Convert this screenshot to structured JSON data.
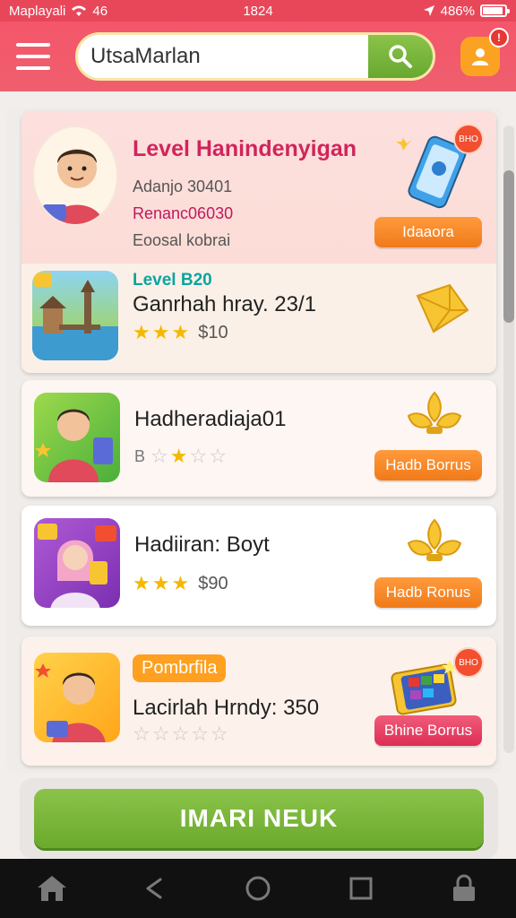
{
  "status_bar": {
    "carrier": "Maplayali",
    "network": "46",
    "time": "1824",
    "battery": "486%",
    "battery_level": 0.86
  },
  "header": {
    "search_value": "UtsaMarlan",
    "notification_count": "!"
  },
  "cards": [
    {
      "title": "Level Hanindenyigan",
      "line1": "Adanjo 30401",
      "line2": "Renanc06030",
      "line3": "Eoosal kobrai",
      "button": "Idaaora",
      "badge": "BHO"
    },
    {
      "level": "Level B20",
      "title": "Ganrhah hray. 23/1",
      "rating": 3,
      "price": "$10"
    },
    {
      "title": "Hadheradiaja01",
      "rating": 1,
      "price_icon": "B",
      "button": "Hadb Borrus"
    },
    {
      "title": "Hadiiran: Boyt",
      "rating": 3,
      "price": "$90",
      "button": "Hadb Ronus"
    },
    {
      "chip": "Pombrfila",
      "title": "Lacirlah Hrndy: 350",
      "rating": 0,
      "button": "Bhine Borrus",
      "badge": "BHO"
    }
  ],
  "primary_button": "IMARI NEUK",
  "colors": {
    "brand": "#f4566a",
    "accent_green": "#7cb342",
    "accent_orange": "#f7871f"
  }
}
